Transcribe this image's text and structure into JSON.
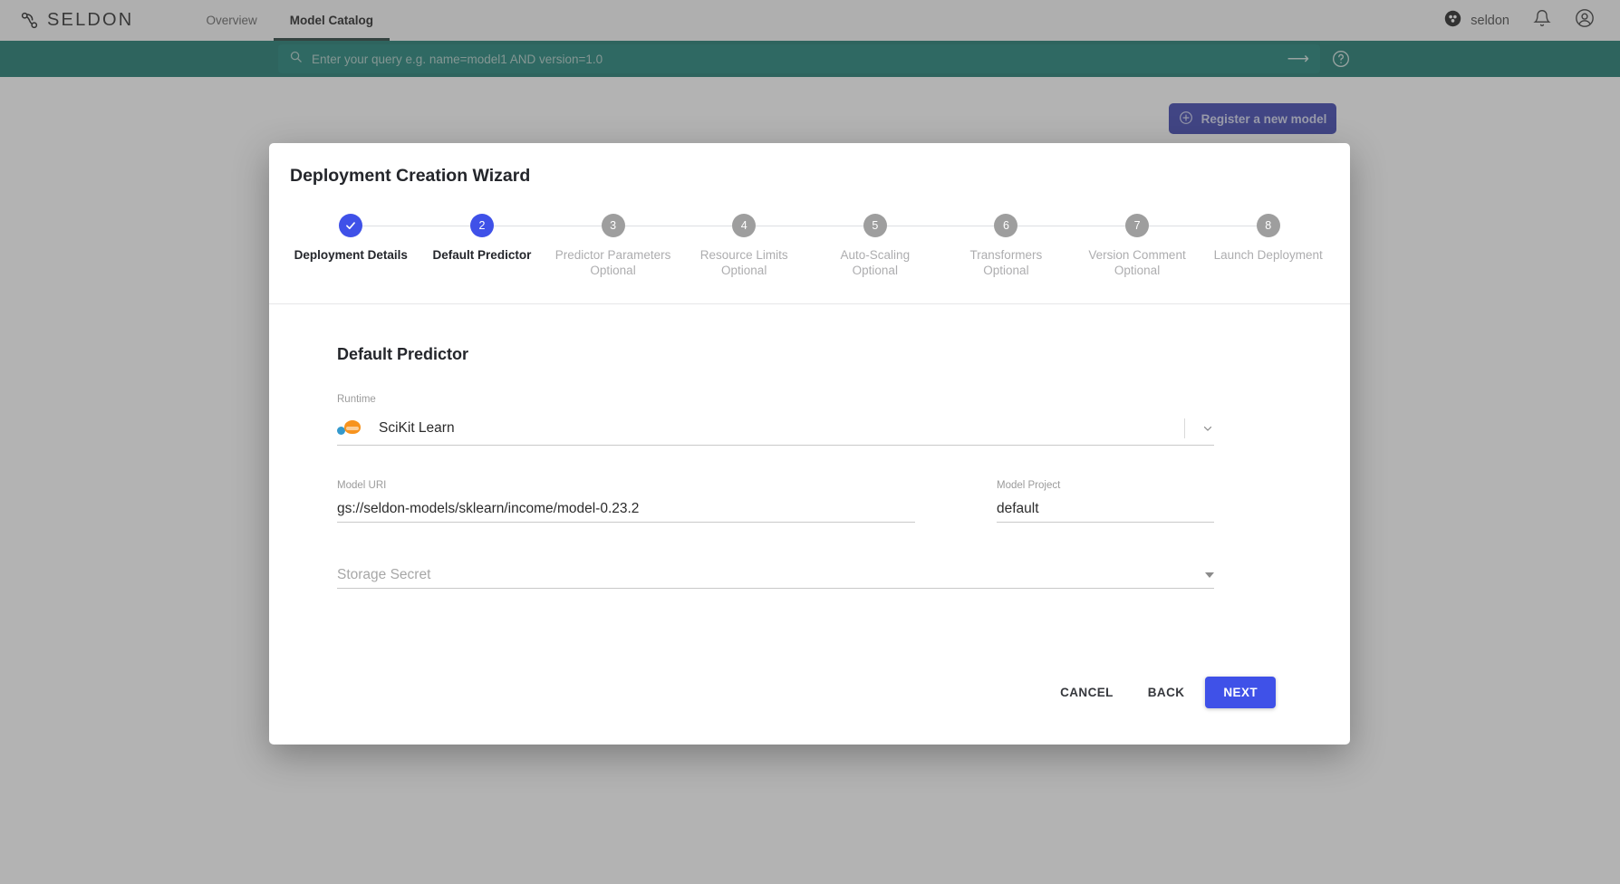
{
  "topnav": {
    "brand": "SELDON",
    "brand_icon": "seldon-logo-icon",
    "items": [
      {
        "label": "Overview",
        "active": false
      },
      {
        "label": "Model Catalog",
        "active": true
      }
    ],
    "org_icon": "org-dots-icon",
    "org_name": "seldon",
    "notification_icon": "bell-icon",
    "account_icon": "account-circle-icon"
  },
  "search": {
    "icon": "search-icon",
    "placeholder": "Enter your query e.g. name=model1 AND version=1.0",
    "value": "",
    "submit_icon": "arrow-right-icon",
    "help_icon": "help-circle-icon"
  },
  "page": {
    "register_button": "Register a new model",
    "register_icon": "plus-circle-icon"
  },
  "modal": {
    "title": "Deployment Creation Wizard",
    "steps": [
      {
        "num": "1",
        "label": "Deployment Details",
        "optional": "",
        "state": "done"
      },
      {
        "num": "2",
        "label": "Default Predictor",
        "optional": "",
        "state": "active"
      },
      {
        "num": "3",
        "label": "Predictor Parameters",
        "optional": "Optional",
        "state": "todo"
      },
      {
        "num": "4",
        "label": "Resource Limits",
        "optional": "Optional",
        "state": "todo"
      },
      {
        "num": "5",
        "label": "Auto-Scaling",
        "optional": "Optional",
        "state": "todo"
      },
      {
        "num": "6",
        "label": "Transformers",
        "optional": "Optional",
        "state": "todo"
      },
      {
        "num": "7",
        "label": "Version Comment",
        "optional": "Optional",
        "state": "todo"
      },
      {
        "num": "8",
        "label": "Launch Deployment",
        "optional": "",
        "state": "todo"
      }
    ],
    "section_title": "Default Predictor",
    "runtime": {
      "label": "Runtime",
      "value": "SciKit Learn",
      "icon": "scikit-learn-logo-icon",
      "chevron_icon": "chevron-down-icon"
    },
    "model_uri": {
      "label": "Model URI",
      "value": "gs://seldon-models/sklearn/income/model-0.23.2"
    },
    "model_project": {
      "label": "Model Project",
      "value": "default"
    },
    "storage_secret": {
      "label": "Storage Secret",
      "value": "",
      "placeholder": "Storage Secret",
      "caret_icon": "caret-down-icon"
    },
    "actions": {
      "cancel": "CANCEL",
      "back": "BACK",
      "next": "NEXT"
    }
  },
  "colors": {
    "accent_blue": "#3f51e8",
    "teal_bar": "#0a6e63",
    "register_blue": "#2e35a8",
    "step_grey": "#9e9e9e"
  }
}
